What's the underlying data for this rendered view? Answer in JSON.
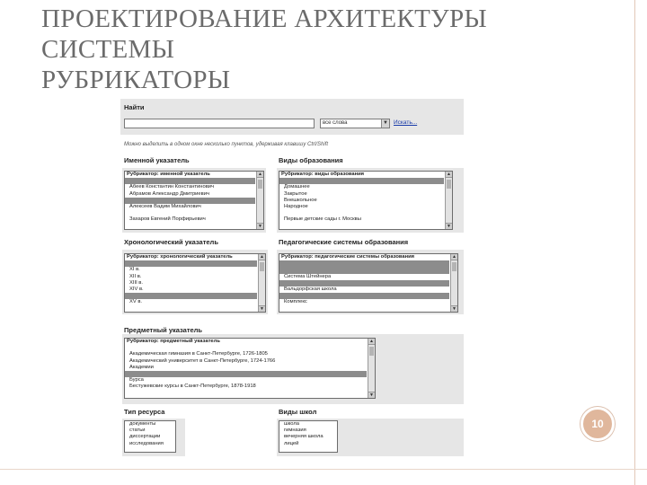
{
  "slide": {
    "title_lines": [
      "ПРОЕКТИРОВАНИЕ АРХИТЕКТУРЫ",
      "СИСТЕМЫ",
      "РУБРИКАТОРЫ"
    ],
    "page_number": "10"
  },
  "form": {
    "search_label": "Найти",
    "search_value": "",
    "scope_select": "все слова",
    "search_link": "Искать...",
    "hint": "Можно выделить в одном окне несколько пунктов, удерживая клавишу Ctrl/Shift",
    "rubricators": [
      {
        "label": "Именной указатель",
        "options": [
          "Рубрикатор: именной указатель",
          "",
          "Абеев Константин Константинович",
          "Абрамов Александр Дмитриевич",
          "",
          "Алексеев Вадим Михайлович",
          "",
          "Захаров Евгений Порфирьевич"
        ],
        "selected": [
          1,
          4
        ]
      },
      {
        "label": "Виды образования",
        "options": [
          "Рубрикатор: виды образования",
          "",
          "Домашнее",
          "Закрытое",
          "Внешкольное",
          "Народное",
          "",
          "Первые детские сады г. Москвы"
        ],
        "selected": [
          1
        ]
      },
      {
        "label": "Хронологический указатель",
        "options": [
          "Рубрикатор: хронологический указатель",
          "",
          "XI в.",
          "XII в.",
          "XIII в.",
          "XIV в.",
          "",
          "XV в."
        ],
        "selected": [
          1,
          6
        ]
      },
      {
        "label": "Педагогические системы образования",
        "options": [
          "Рубрикатор: педагогические системы образования",
          "",
          "",
          "Система Штейнера",
          "",
          "Вальдорфская школа",
          "",
          "Комплекс"
        ],
        "selected": [
          1,
          2,
          4,
          6
        ]
      },
      {
        "label": "Предметный указатель",
        "options": [
          "Рубрикатор: предметный указатель",
          "",
          "Академическая гимназия в Санкт-Петербурге, 1726-1805",
          "Академический университет в Санкт-Петербурге, 1724-1766",
          "Академии",
          "",
          "Бурса",
          "Бестужевские курсы в Санкт-Петербурге, 1878-1918"
        ],
        "selected": [
          5
        ]
      },
      {
        "label": "Тип ресурса",
        "options": [
          "документы",
          "статьи",
          "диссертации",
          "исследования"
        ],
        "selected": []
      },
      {
        "label": "Виды школ",
        "options": [
          "школа",
          "гимназия",
          "вечерняя школа",
          "лицей"
        ],
        "selected": []
      }
    ]
  }
}
